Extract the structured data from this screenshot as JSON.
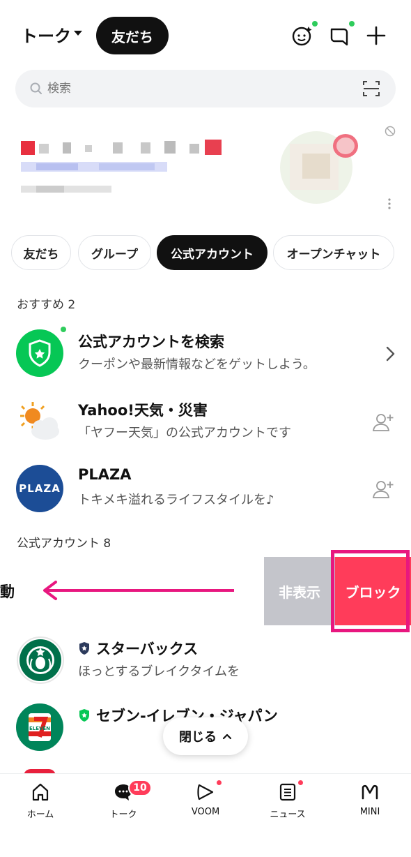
{
  "header": {
    "title": "トーク",
    "active_pill": "友だち",
    "icons": [
      "face-sparkle-icon",
      "chat-bubble-icon",
      "plus-icon"
    ]
  },
  "search": {
    "placeholder": "検索"
  },
  "filters": {
    "chips": [
      "友だち",
      "グループ",
      "公式アカウント",
      "オープンチャット"
    ],
    "active": "公式アカウント"
  },
  "recommended": {
    "label": "おすすめ 2",
    "items": [
      {
        "title": "公式アカウントを検索",
        "subtitle": "クーポンや最新情報などをゲットしよう。",
        "action": "chevron-right-icon"
      },
      {
        "title": "Yahoo!天気・災害",
        "subtitle": "「ヤフー天気」の公式アカウントです",
        "action": "add-friend-icon"
      },
      {
        "title": "PLAZA",
        "subtitle": "トキメキ溢れるライフスタイルを♪",
        "action": "add-friend-icon",
        "logo_text": "PLAZA"
      }
    ]
  },
  "official": {
    "label": "公式アカウント 8",
    "swipe_row": {
      "partial_text": "動",
      "hide_label": "非表示",
      "block_label": "ブロック"
    },
    "items": [
      {
        "title": "スターバックス",
        "subtitle": "ほっとするブレイクタイムを"
      },
      {
        "title": "セブン-イレブン・ジャパン",
        "logo_text": "ELEVEN"
      }
    ]
  },
  "close_pill": {
    "label": "閉じる"
  },
  "bottom_nav": {
    "items": [
      {
        "label": "ホーム",
        "icon": "home-icon"
      },
      {
        "label": "トーク",
        "icon": "talk-icon"
      },
      {
        "label": "VOOM",
        "icon": "voom-icon"
      },
      {
        "label": "ニュース",
        "icon": "news-icon"
      },
      {
        "label": "MINI",
        "icon": "mini-icon"
      }
    ],
    "talk_badge": "10"
  },
  "colors": {
    "line_green": "#06c755",
    "block_red": "#ff3c5a",
    "annotation_pink": "#e8177f",
    "hide_gray": "#c4c5cb"
  }
}
